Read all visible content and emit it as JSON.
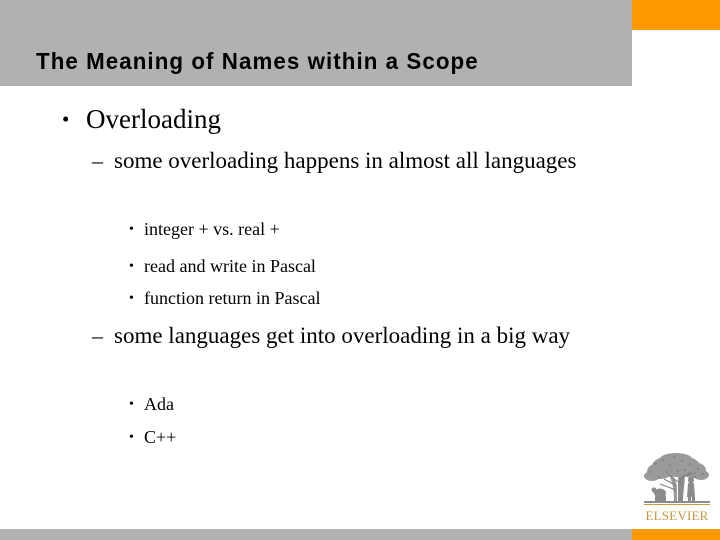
{
  "slide": {
    "title": "The Meaning of Names within a Scope",
    "colors": {
      "title_bar": "#b1b1b1",
      "accent_orange": "#ff9900",
      "text": "#000000",
      "logo_gold": "#c8973f",
      "background": "#ffffff"
    },
    "outline": [
      {
        "level": 1,
        "marker": "•",
        "text": "Overloading"
      },
      {
        "level": 2,
        "marker": "–",
        "text": "some overloading happens in almost all languages"
      },
      {
        "level": 3,
        "marker": "•",
        "text": "integer + vs. real +"
      },
      {
        "level": 3,
        "marker": "•",
        "text": "read and write in Pascal"
      },
      {
        "level": 3,
        "marker": "•",
        "text": "function return in Pascal"
      },
      {
        "level": 2,
        "marker": "–",
        "text": "some languages get into overloading in a big way"
      },
      {
        "level": 3,
        "marker": "•",
        "text": "Ada"
      },
      {
        "level": 3,
        "marker": "•",
        "text": "C++"
      }
    ],
    "logo": {
      "wordmark": "ELSEVIER",
      "icon_name": "elsevier-tree-logo"
    }
  }
}
